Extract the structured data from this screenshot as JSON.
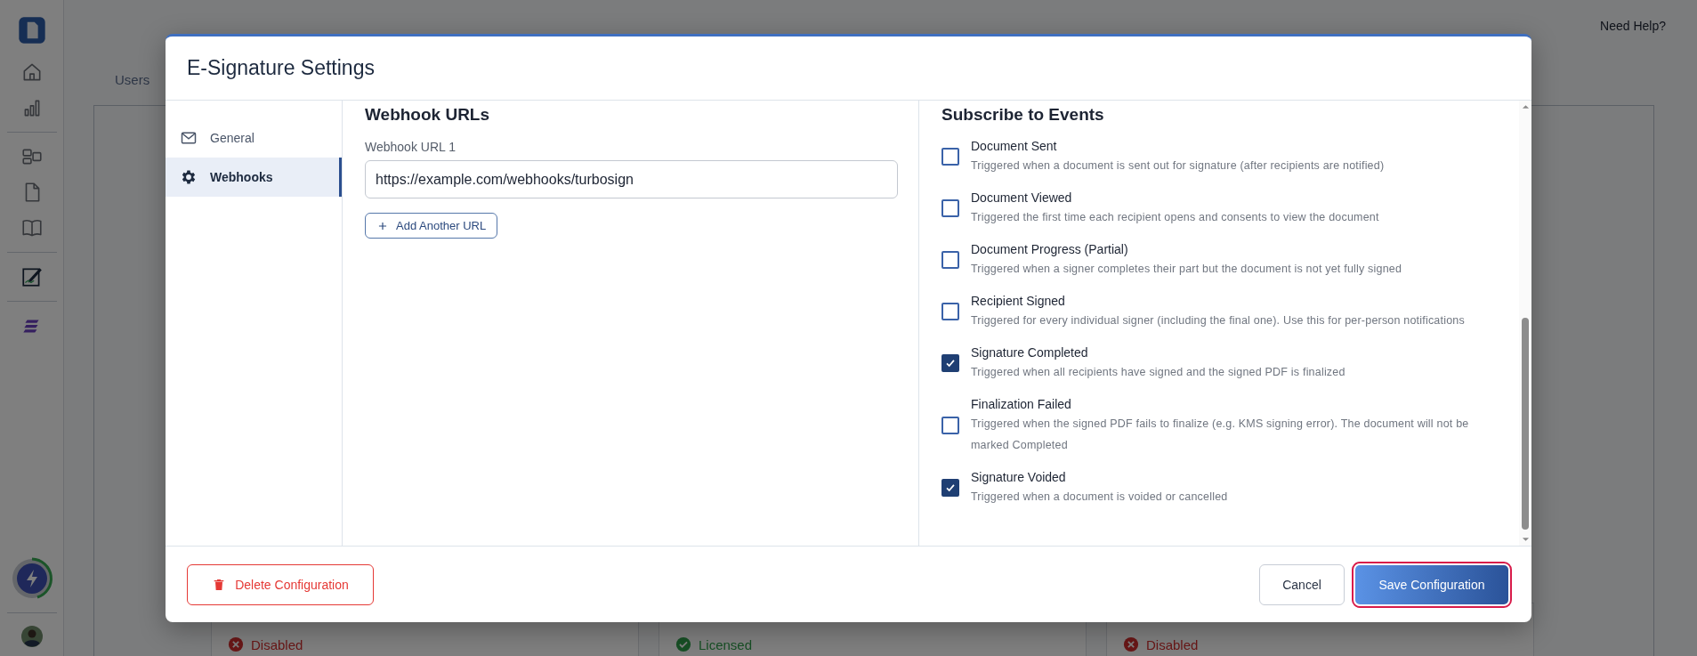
{
  "header": {
    "help_link": "Need Help?"
  },
  "page_tabs": [
    {
      "label": "Users"
    }
  ],
  "integration_cards": [
    {
      "status": "Disabled",
      "kind": "error"
    },
    {
      "status": "Licensed",
      "kind": "ok"
    },
    {
      "status": "Disabled",
      "kind": "error"
    }
  ],
  "dialog": {
    "title": "E-Signature Settings",
    "nav": [
      {
        "label": "General",
        "kind": "mail",
        "selected": false
      },
      {
        "label": "Webhooks",
        "kind": "gear",
        "selected": true
      }
    ],
    "webhooks": {
      "heading": "Webhook URLs",
      "fields": [
        {
          "label": "Webhook URL 1",
          "value": "https://example.com/webhooks/turbosign"
        }
      ],
      "add_button": "Add Another URL"
    },
    "events": {
      "heading": "Subscribe to Events",
      "items": [
        {
          "name": "Document Sent",
          "description": "Triggered when a document is sent out for signature (after recipients are notified)",
          "checked": false
        },
        {
          "name": "Document Viewed",
          "description": "Triggered the first time each recipient opens and consents to view the document",
          "checked": false
        },
        {
          "name": "Document Progress (Partial)",
          "description": "Triggered when a signer completes their part but the document is not yet fully signed",
          "checked": false
        },
        {
          "name": "Recipient Signed",
          "description": "Triggered for every individual signer (including the final one). Use this for per-person notifications",
          "checked": false
        },
        {
          "name": "Signature Completed",
          "description": "Triggered when all recipients have signed and the signed PDF is finalized",
          "checked": true
        },
        {
          "name": "Finalization Failed",
          "description": "Triggered when the signed PDF fails to finalize (e.g. KMS signing error). The document will not be marked Completed",
          "checked": false
        },
        {
          "name": "Signature Voided",
          "description": "Triggered when a document is voided or cancelled",
          "checked": true
        }
      ]
    },
    "buttons": {
      "delete": "Delete Configuration",
      "cancel": "Cancel",
      "save": "Save Configuration"
    }
  }
}
